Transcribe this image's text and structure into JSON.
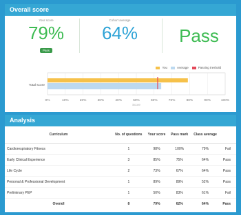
{
  "overall_score": {
    "title": "Overall score",
    "you_caption": "Your score",
    "you_value": "79%",
    "you_badge": "Pass",
    "cohort_caption": "Cohort average",
    "cohort_value": "64%",
    "result": "Pass"
  },
  "chart_data": {
    "type": "bar",
    "orientation": "horizontal",
    "categories": [
      "Total score"
    ],
    "series": [
      {
        "name": "You",
        "values": [
          79
        ],
        "color": "#f6c14a"
      },
      {
        "name": "Average",
        "values": [
          64
        ],
        "color": "#bcd9f0"
      }
    ],
    "passing_threshold": {
      "name": "Passing treshold",
      "value": 62,
      "color": "#e4495a"
    },
    "xlim": [
      0,
      100
    ],
    "x_ticks": [
      "0%",
      "10%",
      "20%",
      "30%",
      "40%",
      "50%",
      "60%",
      "70%",
      "80%",
      "90%",
      "100%"
    ],
    "xlabel": "Score",
    "legend": "top-right",
    "grid": true
  },
  "legend_labels": {
    "you": "You",
    "average": "Average",
    "threshold": "Passing treshold"
  },
  "analysis": {
    "title": "Analysis",
    "headers": [
      "Curriculum",
      "No. of questions",
      "Your score",
      "Pass mark",
      "Class average",
      ""
    ],
    "rows": [
      [
        "Cardiorespiratory Fitness",
        "1",
        "98%",
        "100%",
        "79%",
        "Fail"
      ],
      [
        "Early Clinical Experience",
        "3",
        "85%",
        "75%",
        "64%",
        "Pass"
      ],
      [
        "Life Cycle",
        "2",
        "73%",
        "67%",
        "64%",
        "Pass"
      ],
      [
        "Personal & Professional Development",
        "1",
        "89%",
        "89%",
        "52%",
        "Pass"
      ],
      [
        "Preliminary PEP",
        "1",
        "50%",
        "83%",
        "61%",
        "Fail"
      ]
    ],
    "overall": [
      "Overall",
      "8",
      "79%",
      "62%",
      "64%",
      "Pass"
    ]
  }
}
